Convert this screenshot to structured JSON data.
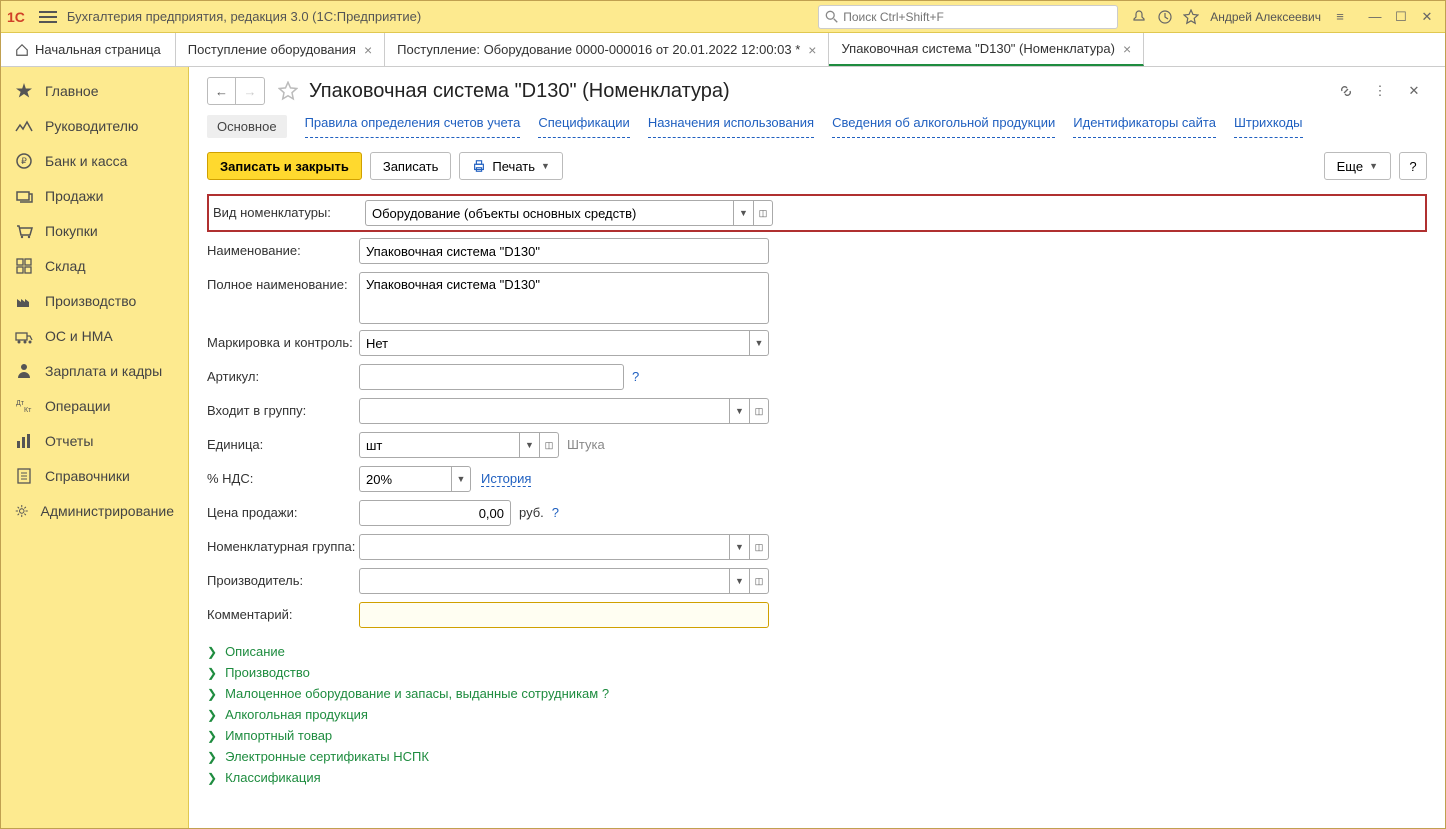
{
  "titlebar": {
    "app_title": "Бухгалтерия предприятия, редакция 3.0  (1С:Предприятие)",
    "search_placeholder": "Поиск Ctrl+Shift+F",
    "user_name": "Андрей Алексеевич"
  },
  "tabs": {
    "home": "Начальная страница",
    "items": [
      {
        "label": "Поступление оборудования",
        "active": false
      },
      {
        "label": "Поступление: Оборудование 0000-000016 от 20.01.2022 12:00:03 *",
        "active": false
      },
      {
        "label": "Упаковочная система \"D130\" (Номенклатура)",
        "active": true
      }
    ]
  },
  "sidebar": {
    "items": [
      {
        "label": "Главное"
      },
      {
        "label": "Руководителю"
      },
      {
        "label": "Банк и касса"
      },
      {
        "label": "Продажи"
      },
      {
        "label": "Покупки"
      },
      {
        "label": "Склад"
      },
      {
        "label": "Производство"
      },
      {
        "label": "ОС и НМА"
      },
      {
        "label": "Зарплата и кадры"
      },
      {
        "label": "Операции"
      },
      {
        "label": "Отчеты"
      },
      {
        "label": "Справочники"
      },
      {
        "label": "Администрирование"
      }
    ]
  },
  "page": {
    "title": "Упаковочная система \"D130\" (Номенклатура)"
  },
  "subnav": {
    "items": [
      {
        "label": "Основное",
        "active": true
      },
      {
        "label": "Правила определения счетов учета"
      },
      {
        "label": "Спецификации"
      },
      {
        "label": "Назначения использования"
      },
      {
        "label": "Сведения об алкогольной продукции"
      },
      {
        "label": "Идентификаторы сайта"
      },
      {
        "label": "Штрихкоды"
      }
    ]
  },
  "toolbar": {
    "save_close": "Записать и закрыть",
    "save": "Записать",
    "print": "Печать",
    "more": "Еще",
    "help": "?"
  },
  "form": {
    "type_label": "Вид номенклатуры:",
    "type_value": "Оборудование (объекты основных средств)",
    "name_label": "Наименование:",
    "name_value": "Упаковочная система \"D130\"",
    "fullname_label": "Полное наименование:",
    "fullname_value": "Упаковочная система \"D130\"",
    "marking_label": "Маркировка и контроль:",
    "marking_value": "Нет",
    "article_label": "Артикул:",
    "article_value": "",
    "group_label": "Входит в группу:",
    "group_value": "",
    "unit_label": "Единица:",
    "unit_value": "шт",
    "unit_hint": "Штука",
    "vat_label": "% НДС:",
    "vat_value": "20%",
    "vat_history": "История",
    "price_label": "Цена продажи:",
    "price_value": "0,00",
    "price_unit": "руб.",
    "nomgroup_label": "Номенклатурная группа:",
    "nomgroup_value": "",
    "manufacturer_label": "Производитель:",
    "manufacturer_value": "",
    "comment_label": "Комментарий:",
    "comment_value": ""
  },
  "expands": [
    {
      "label": "Описание"
    },
    {
      "label": "Производство"
    },
    {
      "label": "Малоценное оборудование и запасы, выданные сотрудникам",
      "help": true
    },
    {
      "label": "Алкогольная продукция"
    },
    {
      "label": "Импортный товар"
    },
    {
      "label": "Электронные сертификаты НСПК"
    },
    {
      "label": "Классификация"
    }
  ]
}
